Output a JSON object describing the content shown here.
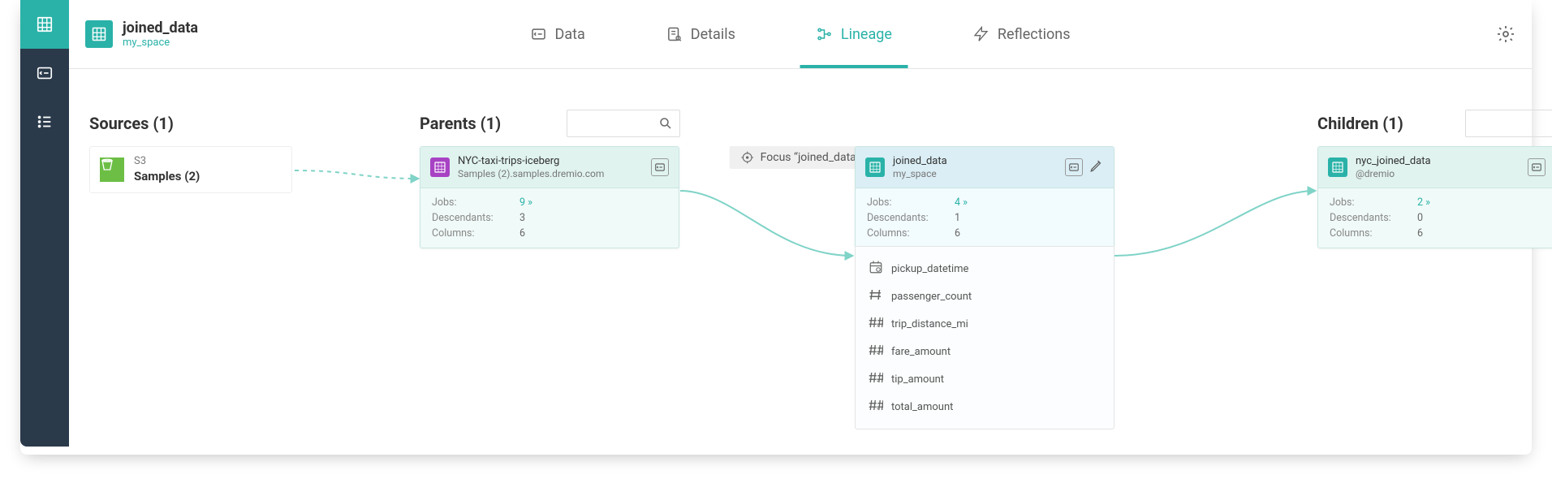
{
  "header": {
    "dataset_name": "joined_data",
    "dataset_path": "my_space"
  },
  "tabs": {
    "data": "Data",
    "details": "Details",
    "lineage": "Lineage",
    "reflections": "Reflections"
  },
  "focus": {
    "label": "Focus “joined_data”"
  },
  "columns": {
    "sources_label": "Sources (1)",
    "parents_label": "Parents (1)",
    "children_label": "Children (1)"
  },
  "source_node": {
    "type": "S3",
    "name": "Samples (2)"
  },
  "parent_node": {
    "title": "NYC-taxi-trips-iceberg",
    "subtitle": "Samples (2).samples.dremio.com",
    "jobs_label": "Jobs:",
    "jobs_val": "9 »",
    "desc_label": "Descendants:",
    "desc_val": "3",
    "cols_label": "Columns:",
    "cols_val": "6"
  },
  "focus_node": {
    "title": "joined_data",
    "subtitle": "my_space",
    "jobs_label": "Jobs:",
    "jobs_val": "4 »",
    "desc_label": "Descendants:",
    "desc_val": "1",
    "cols_label": "Columns:",
    "cols_val": "6",
    "fields": [
      {
        "name": "pickup_datetime",
        "type": "datetime"
      },
      {
        "name": "passenger_count",
        "type": "int"
      },
      {
        "name": "trip_distance_mi",
        "type": "float"
      },
      {
        "name": "fare_amount",
        "type": "float"
      },
      {
        "name": "tip_amount",
        "type": "float"
      },
      {
        "name": "total_amount",
        "type": "float"
      }
    ]
  },
  "child_node": {
    "title": "nyc_joined_data",
    "subtitle": "@dremio",
    "jobs_label": "Jobs:",
    "jobs_val": "2 »",
    "desc_label": "Descendants:",
    "desc_val": "0",
    "cols_label": "Columns:",
    "cols_val": "6"
  }
}
